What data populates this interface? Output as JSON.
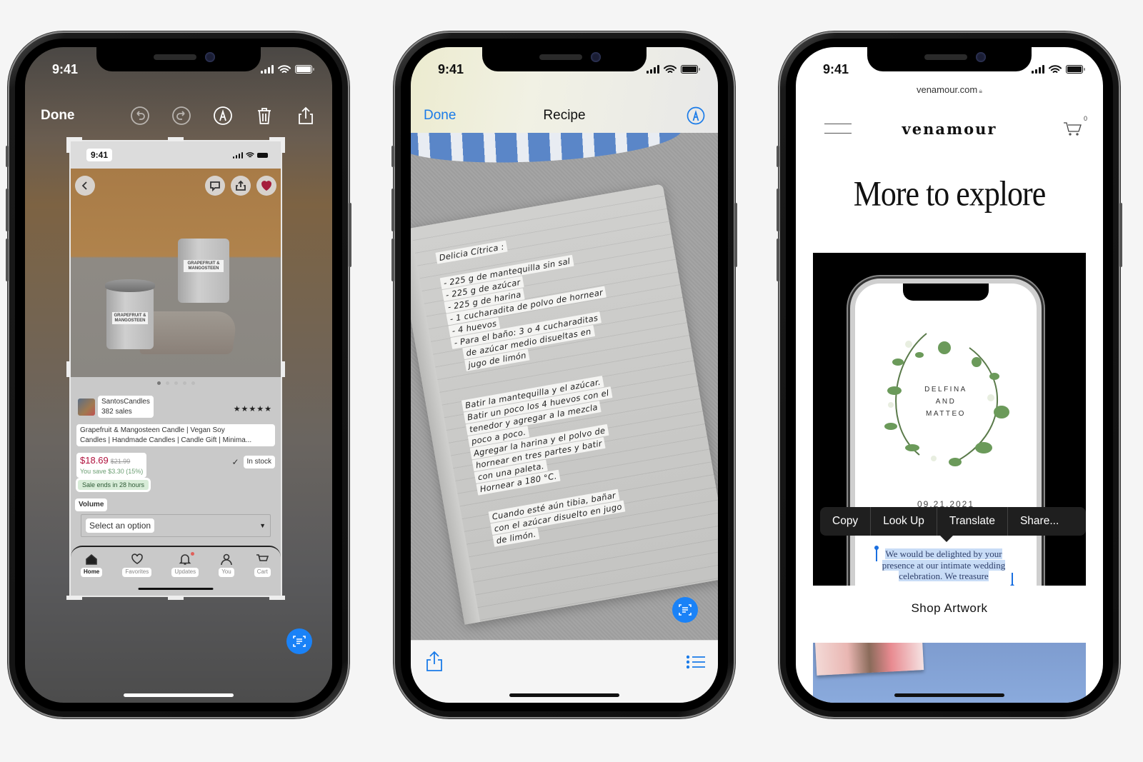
{
  "phones": [
    {
      "status": {
        "time": "9:41"
      },
      "toolbar": {
        "done_label": "Done",
        "icons": [
          "undo-icon",
          "redo-icon",
          "markup-icon",
          "trash-icon",
          "share-icon"
        ]
      },
      "screenshot": {
        "status_time": "9:41",
        "header_icons": [
          "back-chevron-icon",
          "message-icon",
          "share-icon",
          "heart-icon"
        ],
        "product_labels": [
          "GRAPEFRUIT & MANGOSTEEN",
          "GRAPEFRUIT & MANGOSTEEN"
        ],
        "carousel": {
          "count": 5,
          "active": 0
        },
        "seller": {
          "name": "SantosCandles",
          "sales": "382 sales"
        },
        "rating": "★★★★★",
        "title_line1": "Grapefruit & Mangosteen Candle | Vegan Soy",
        "title_line2": "Candles | Handmade Candles | Candle Gift | Minima...",
        "price": "$18.69",
        "original_price": "$21.99",
        "savings": "You save $3.30 (15%)",
        "sale_badge": "Sale ends in 28 hours",
        "stock": "In stock",
        "option_label": "Volume",
        "select_placeholder": "Select an option",
        "tabs": [
          {
            "label": "Home",
            "icon": "home-icon",
            "active": true
          },
          {
            "label": "Favorites",
            "icon": "heart-icon",
            "active": false
          },
          {
            "label": "Updates",
            "icon": "bell-icon",
            "active": false
          },
          {
            "label": "You",
            "icon": "person-icon",
            "active": false
          },
          {
            "label": "Cart",
            "icon": "cart-icon",
            "active": false
          }
        ]
      },
      "live_text_icon": "live-text-icon"
    },
    {
      "status": {
        "time": "9:41"
      },
      "nav": {
        "done_label": "Done",
        "title": "Recipe",
        "markup_icon": "markup-icon"
      },
      "recipe_text": {
        "title": "Delicia Cítrica :",
        "ingredients": [
          "- 225 g de mantequilla sin sal",
          "- 225 g de azúcar",
          "- 225 g de harina",
          "- 1 cucharadita de polvo de hornear",
          "- 4 huevos",
          "- Para el baño: 3 o 4 cucharaditas",
          "de azúcar medio disueltas en",
          "jugo de limón"
        ],
        "steps": [
          "Batir la mantequilla y el azúcar.",
          "Batir un poco los 4 huevos con el",
          "tenedor y agregar a la mezcla",
          "poco a poco.",
          "Agregar la harina y el polvo de",
          "hornear en tres partes y batir",
          "con una paleta.",
          "Hornear a 180 °C."
        ],
        "finish": [
          "Cuando esté aún tibia, bañar",
          "con el azúcar disuelto en jugo",
          "de limón."
        ]
      },
      "bottom_icons": [
        "share-icon",
        "list-icon"
      ]
    },
    {
      "status": {
        "time": "9:41"
      },
      "url": "venamour.com",
      "site": {
        "logo": "venamour",
        "cart_count": "0",
        "headline": "More to explore",
        "invitation": {
          "line1": "DELFINA",
          "line2": "AND",
          "line3": "MATTEO",
          "date": "09.21.2021"
        },
        "context_menu": [
          "Copy",
          "Look Up",
          "Translate",
          "Share..."
        ],
        "selected_text": "We would be delighted by your presence at our intimate wedding celebration. We treasure",
        "shop_link": "Shop Artwork"
      }
    }
  ],
  "colors": {
    "ios_blue": "#1a7be8",
    "live_text_blue": "#1a82f7",
    "price_red": "#b0103c",
    "selection": "#c8dcf6"
  }
}
